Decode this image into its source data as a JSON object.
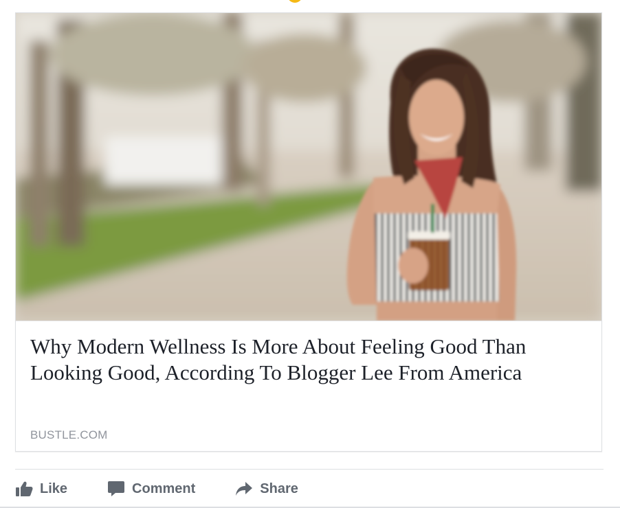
{
  "post": {
    "link": {
      "headline": "Why Modern Wellness Is More About Feeling Good Than Looking Good, According To Blogger Lee From America",
      "domain": "BUSTLE.COM"
    },
    "actions": {
      "like": "Like",
      "comment": "Comment",
      "share": "Share"
    }
  },
  "colors": {
    "action_text": "#606770",
    "domain_text": "#90949c",
    "headline_text": "#1d2129"
  },
  "icons": {
    "like": "thumbs-up-icon",
    "comment": "comment-bubble-icon",
    "share": "share-arrow-icon"
  }
}
